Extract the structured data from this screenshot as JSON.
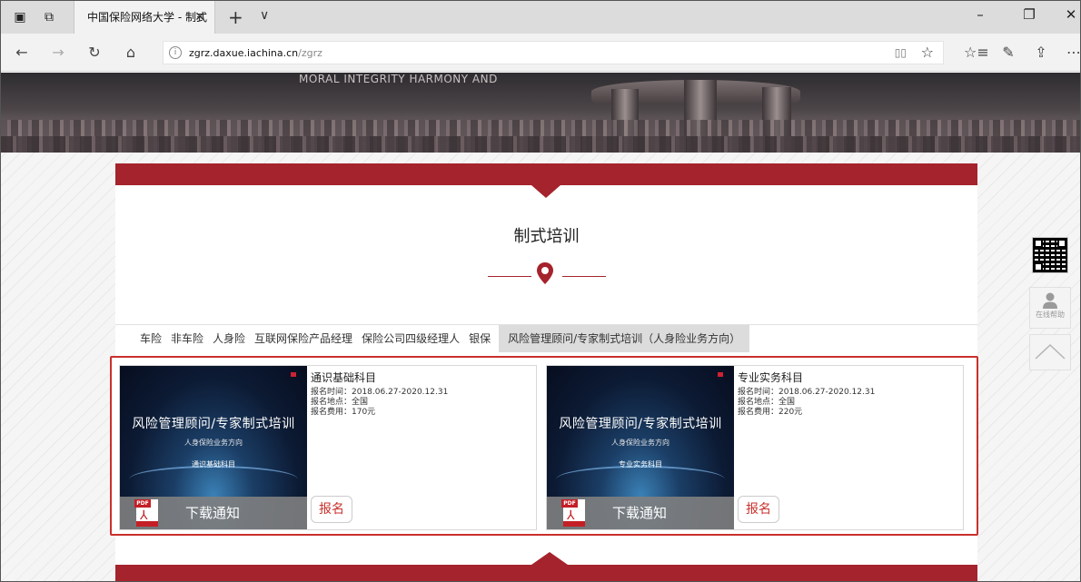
{
  "browser": {
    "tab_title": "中国保险网络大学 - 制式",
    "tab_close": "✕",
    "new_tab": "+",
    "tab_menu": "∨",
    "url_host": "zgrz.daxue.iachina.cn",
    "url_path": "/zgrz"
  },
  "banner": {
    "motto": "MORAL INTEGRITY HARMONY AND"
  },
  "section": {
    "title": "制式培训"
  },
  "tabs": [
    {
      "label": "车险",
      "active": false
    },
    {
      "label": "非车险",
      "active": false
    },
    {
      "label": "人身险",
      "active": false
    },
    {
      "label": "互联网保险产品经理",
      "active": false
    },
    {
      "label": "保险公司四级经理人",
      "active": false
    },
    {
      "label": "银保",
      "active": false
    },
    {
      "label": "风险管理顾问/专家制式培训（人身险业务方向）",
      "active": true
    }
  ],
  "cards": [
    {
      "thumb_title": "风险管理顾问/专家制式培训",
      "thumb_sub": "人身保险业务方向",
      "thumb_subject": "通识基础科目",
      "title": "通识基础科目",
      "reg_time": "报名时间：2018.06.27-2020.12.31",
      "reg_place": "报名地点：全国",
      "reg_fee": "报名费用：170元",
      "download_label": "下载通知",
      "signup_label": "报名"
    },
    {
      "thumb_title": "风险管理顾问/专家制式培训",
      "thumb_sub": "人身保险业务方向",
      "thumb_subject": "专业实务科目",
      "title": "专业实务科目",
      "reg_time": "报名时间：2018.06.27-2020.12.31",
      "reg_place": "报名地点：全国",
      "reg_fee": "报名费用：220元",
      "download_label": "下载通知",
      "signup_label": "报名"
    }
  ],
  "pdf": {
    "tag": "PDF"
  },
  "side": {
    "help_text": "在线帮助"
  },
  "colors": {
    "brand_red": "#a5232c",
    "highlight_border": "#c9302c"
  }
}
